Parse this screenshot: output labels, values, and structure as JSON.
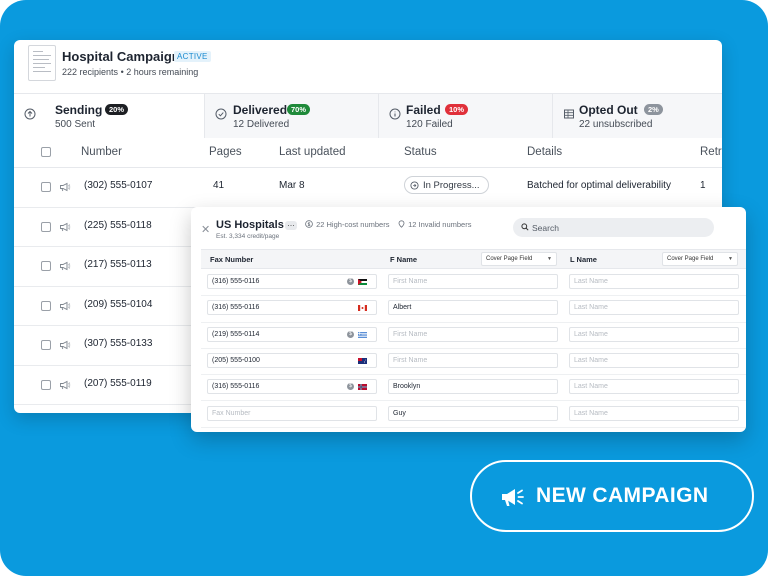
{
  "campaign": {
    "title": "Hospital Campaign",
    "status_badge": "ACTIVE",
    "recipients": "222 recipients",
    "remaining": "2 hours remaining"
  },
  "tabs": [
    {
      "label": "Sending",
      "badge": "20%",
      "badge_color": "#1d1f23",
      "sub": "500 Sent",
      "icon": "arrow-up-circle-icon"
    },
    {
      "label": "Delivered",
      "badge": "70%",
      "badge_color": "#1f8a3a",
      "sub": "12 Delivered",
      "icon": "check-circle-icon"
    },
    {
      "label": "Failed",
      "badge": "10%",
      "badge_color": "#e0303a",
      "sub": "120 Failed",
      "icon": "info-circle-icon"
    },
    {
      "label": "Opted Out",
      "badge": "2%",
      "badge_color": "#8d949d",
      "sub": "22 unsubscribed",
      "icon": "table-icon"
    }
  ],
  "table": {
    "headers": [
      "Number",
      "Pages",
      "Last updated",
      "Status",
      "Details",
      "Retr"
    ],
    "rows": [
      {
        "number": "(302) 555-0107",
        "pages": "41",
        "updated": "Mar 8",
        "status": "In Progress...",
        "details": "Batched for optimal deliverability",
        "retries": "1"
      },
      {
        "number": "(225) 555-0118"
      },
      {
        "number": "(217) 555-0113"
      },
      {
        "number": "(209) 555-0104"
      },
      {
        "number": "(307) 555-0133"
      },
      {
        "number": "(207) 555-0119"
      }
    ]
  },
  "list_panel": {
    "title": "US Hospitals",
    "more": "…",
    "estimate": "Est. 3,334 credit/page",
    "high_cost": "22 High-cost numbers",
    "invalid": "12 Invalid numbers",
    "search_placeholder": "Search",
    "headers": {
      "fax": "Fax Number",
      "fname": "F Name",
      "lname": "L Name",
      "field_select": "Cover Page Field"
    },
    "rows": [
      {
        "fax": "(316) 555-0116",
        "fname": "",
        "lname": "",
        "cost": true,
        "flag": "jo"
      },
      {
        "fax": "(316) 555-0116",
        "fname": "Albert",
        "lname": "",
        "cost": false,
        "flag": "ca"
      },
      {
        "fax": "(219) 555-0114",
        "fname": "",
        "lname": "",
        "cost": true,
        "flag": "gr"
      },
      {
        "fax": "(205) 555-0100",
        "fname": "",
        "lname": "",
        "cost": false,
        "flag": "au"
      },
      {
        "fax": "(316) 555-0116",
        "fname": "Brooklyn",
        "lname": "",
        "cost": true,
        "flag": "no"
      },
      {
        "fax": "",
        "fname": "Guy",
        "lname": "",
        "cost": false,
        "flag": ""
      }
    ],
    "placeholders": {
      "fax": "Fax Number",
      "fname": "First Name",
      "lname": "Last Name"
    }
  },
  "cta": {
    "label": "NEW CAMPAIGN",
    "icon": "megaphone-icon"
  },
  "colors": {
    "background": "#0a9ade",
    "accent": "#1b8bd0"
  }
}
